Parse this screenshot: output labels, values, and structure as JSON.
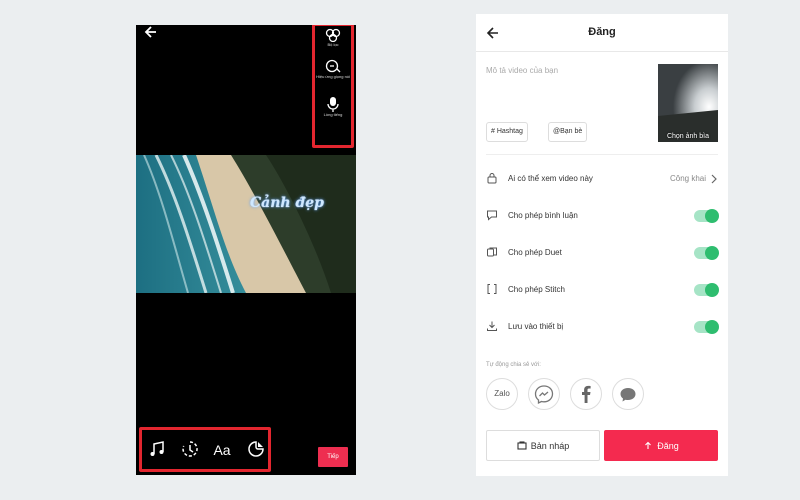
{
  "editor": {
    "right_tools": [
      {
        "icon": "effects-icon",
        "label": "Bộ lọc"
      },
      {
        "icon": "voice-effect-icon",
        "label": "Hiệu ứng giọng nói"
      },
      {
        "icon": "microphone-icon",
        "label": "Lồng tiếng"
      }
    ],
    "video_caption": "Cảnh đẹp",
    "bottom_tools": [
      {
        "icon": "music-note-icon"
      },
      {
        "icon": "timer-effect-icon"
      },
      {
        "icon": "text-icon",
        "label": "Aa"
      },
      {
        "icon": "sticker-icon"
      }
    ],
    "next_label": "Tiếp"
  },
  "post": {
    "title": "Đăng",
    "description_placeholder": "Mô tả video của bạn",
    "cover_label": "Chọn ảnh bìa",
    "hashtag_label": "# Hashtag",
    "mention_label": "@Bạn bè",
    "privacy": {
      "label": "Ai có thể xem video này",
      "value": "Công khai"
    },
    "toggles": [
      {
        "label": "Cho phép bình luận",
        "icon": "comment-icon",
        "on": true
      },
      {
        "label": "Cho phép Duet",
        "icon": "duet-icon",
        "on": true
      },
      {
        "label": "Cho phép Stitch",
        "icon": "stitch-icon",
        "on": true
      },
      {
        "label": "Lưu vào thiết bị",
        "icon": "download-icon",
        "on": true
      }
    ],
    "share_label": "Tự động chia sẻ với:",
    "share_targets": [
      "Zalo",
      "Messenger",
      "Facebook",
      "Message"
    ],
    "zalo_text": "Zalo",
    "draft_label": "Bản nháp",
    "post_label": "Đăng"
  },
  "colors": {
    "highlight": "#e3262f",
    "primary": "#f42a4f",
    "toggle_on": "#2ebd6f"
  }
}
